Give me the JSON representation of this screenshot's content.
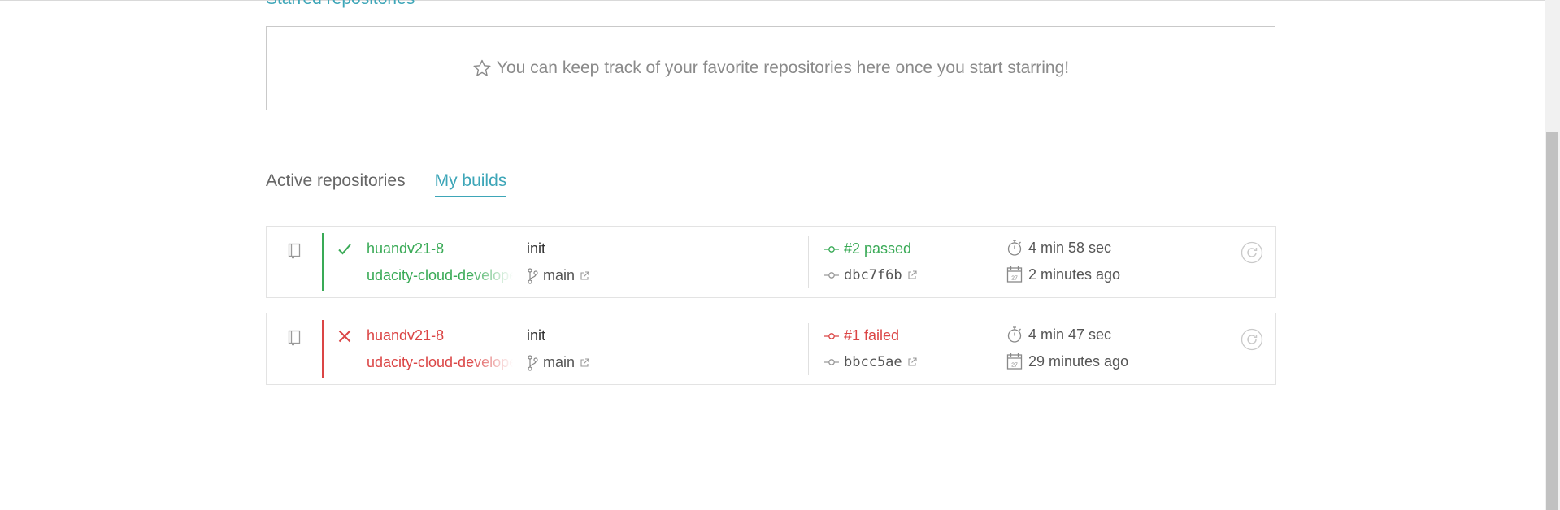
{
  "starred": {
    "title": "Starred repositories",
    "empty_message": "You can keep track of your favorite repositories here once you start starring!"
  },
  "tabs": [
    {
      "label": "Active repositories",
      "active": false
    },
    {
      "label": "My builds",
      "active": true
    }
  ],
  "builds": [
    {
      "status": "passed",
      "owner": "huandv21-8",
      "repo": "udacity-cloud-developer",
      "commit_message": "init",
      "branch": "main",
      "build_label": "#2 passed",
      "commit_sha": "dbc7f6b",
      "duration": "4 min 58 sec",
      "finished": "2 minutes ago"
    },
    {
      "status": "failed",
      "owner": "huandv21-8",
      "repo": "udacity-cloud-developer",
      "commit_message": "init",
      "branch": "main",
      "build_label": "#1 failed",
      "commit_sha": "bbcc5ae",
      "duration": "4 min 47 sec",
      "finished": "29 minutes ago"
    }
  ],
  "colors": {
    "passed": "#39aa56",
    "failed": "#db4545",
    "accent": "#3ea6b8"
  }
}
